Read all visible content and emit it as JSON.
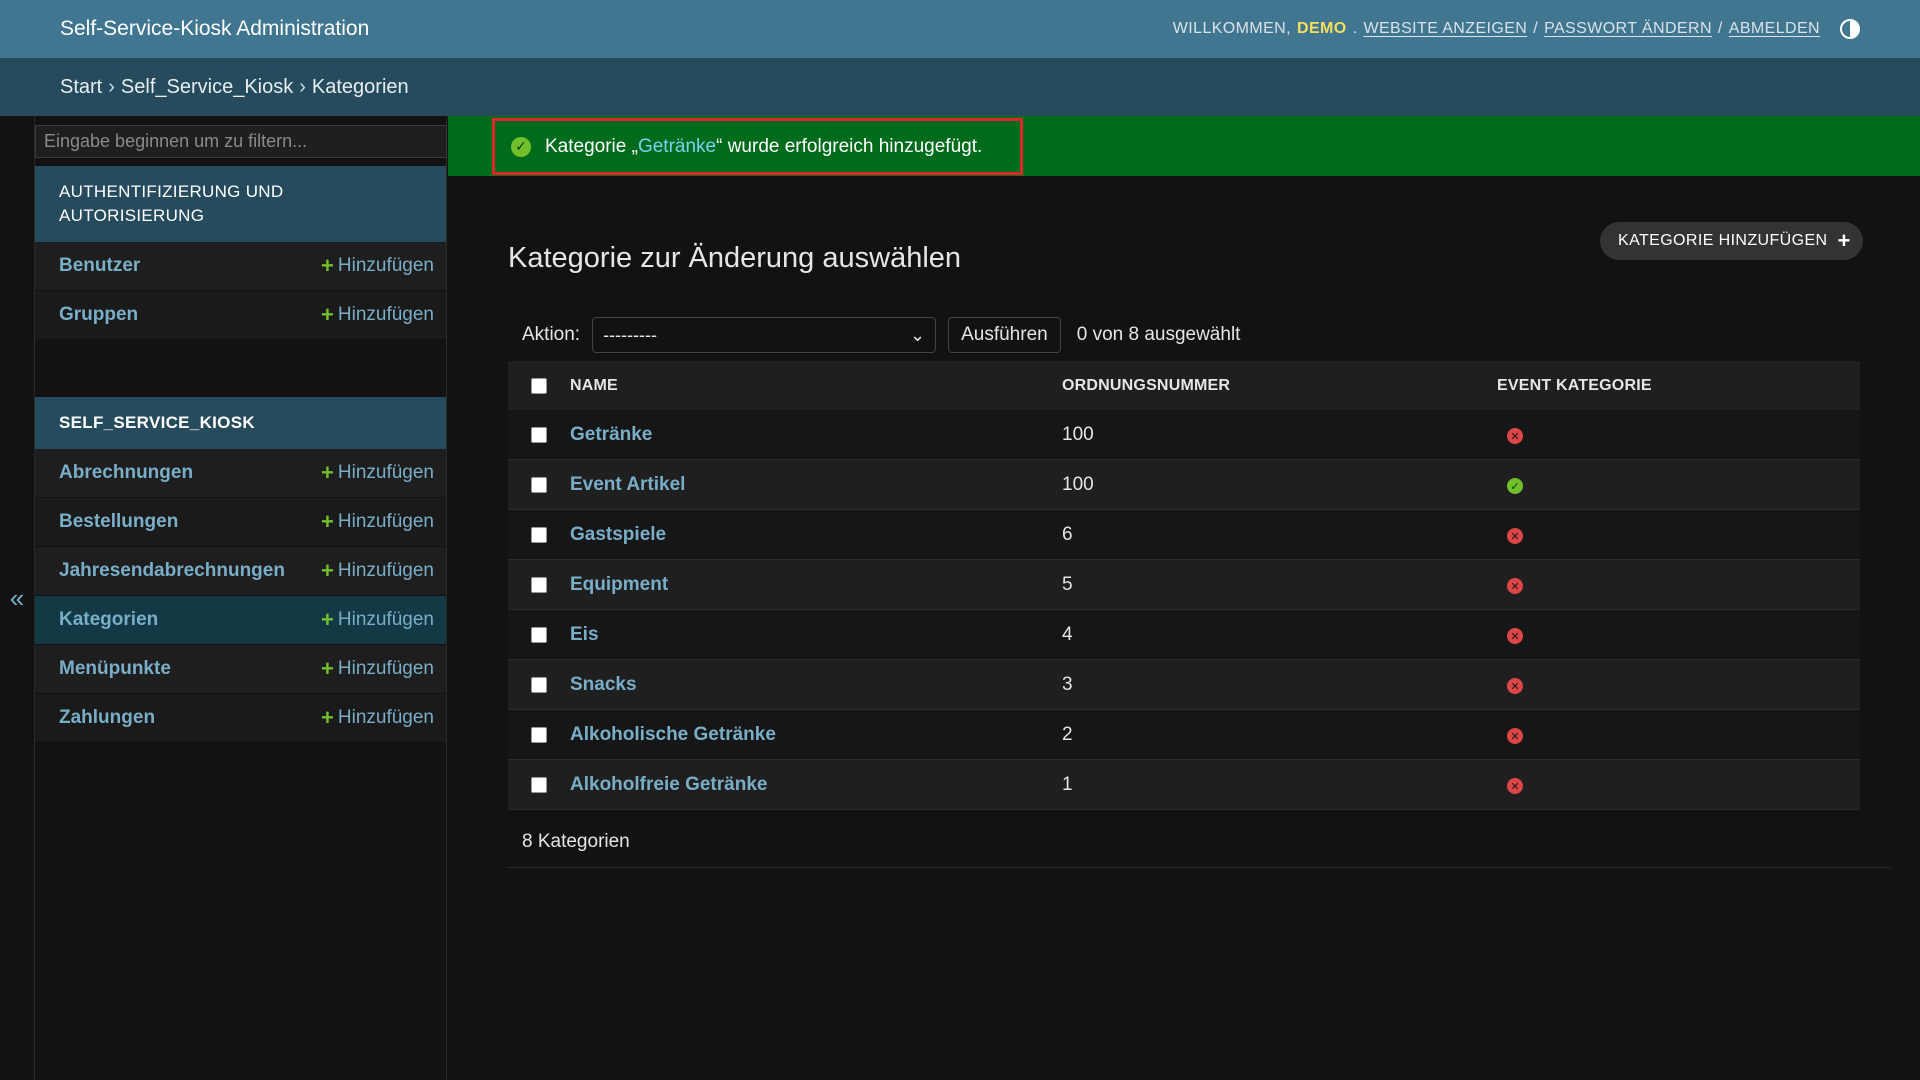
{
  "header": {
    "brand": "Self-Service-Kiosk Administration",
    "welcome": "WILLKOMMEN,",
    "user": "DEMO",
    "view_site": "WEBSITE ANZEIGEN",
    "change_password": "PASSWORT ÄNDERN",
    "logout": "ABMELDEN",
    "separator": "/"
  },
  "breadcrumbs": [
    "Start",
    "Self_Service_Kiosk",
    "Kategorien"
  ],
  "breadcrumb_sep": "›",
  "sidebar": {
    "filter_placeholder": "Eingabe beginnen um zu filtern...",
    "collapse_glyph": "«",
    "add_label": "Hinzufügen",
    "auth_caption": "AUTHENTIFIZIERUNG UND AUTORISIERUNG",
    "auth_items": [
      "Benutzer",
      "Gruppen"
    ],
    "kiosk_caption": "SELF_SERVICE_KIOSK",
    "kiosk_items": [
      "Abrechnungen",
      "Bestellungen",
      "Jahresendabrechnungen",
      "Kategorien",
      "Menüpunkte",
      "Zahlungen"
    ]
  },
  "message": {
    "prefix": "Kategorie „",
    "link": "Getränke",
    "suffix": "“ wurde erfolgreich hinzugefügt."
  },
  "main": {
    "title": "Kategorie zur Änderung auswählen",
    "add_button": "KATEGORIE HINZUFÜGEN",
    "action_label": "Aktion:",
    "action_selected": "---------",
    "run_button": "Ausführen",
    "selection_counter": "0 von 8 ausgewählt",
    "columns": [
      "NAME",
      "ORDNUNGSNUMMER",
      "EVENT KATEGORIE"
    ],
    "rows": [
      {
        "name": "Getränke",
        "order": "100",
        "event": false
      },
      {
        "name": "Event Artikel",
        "order": "100",
        "event": true
      },
      {
        "name": "Gastspiele",
        "order": "6",
        "event": false
      },
      {
        "name": "Equipment",
        "order": "5",
        "event": false
      },
      {
        "name": "Eis",
        "order": "4",
        "event": false
      },
      {
        "name": "Snacks",
        "order": "3",
        "event": false
      },
      {
        "name": "Alkoholische Getränke",
        "order": "2",
        "event": false
      },
      {
        "name": "Alkoholfreie Getränke",
        "order": "1",
        "event": false
      }
    ],
    "paginator": "8 Kategorien"
  },
  "colors": {
    "header_bg": "#417690",
    "breadcrumb_bg": "#264b5d",
    "link": "#79aec8",
    "success_bg": "#006b1b",
    "highlight_border": "#e0262c"
  }
}
